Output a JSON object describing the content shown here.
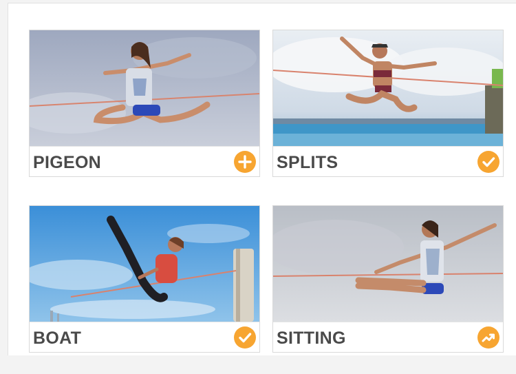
{
  "accent_color": "#f7a531",
  "poses": [
    {
      "label": "PIGEON",
      "status_icon": "plus-icon"
    },
    {
      "label": "SPLITS",
      "status_icon": "check-icon"
    },
    {
      "label": "BOAT",
      "status_icon": "check-icon"
    },
    {
      "label": "SITTING",
      "status_icon": "trending-up-icon"
    }
  ]
}
